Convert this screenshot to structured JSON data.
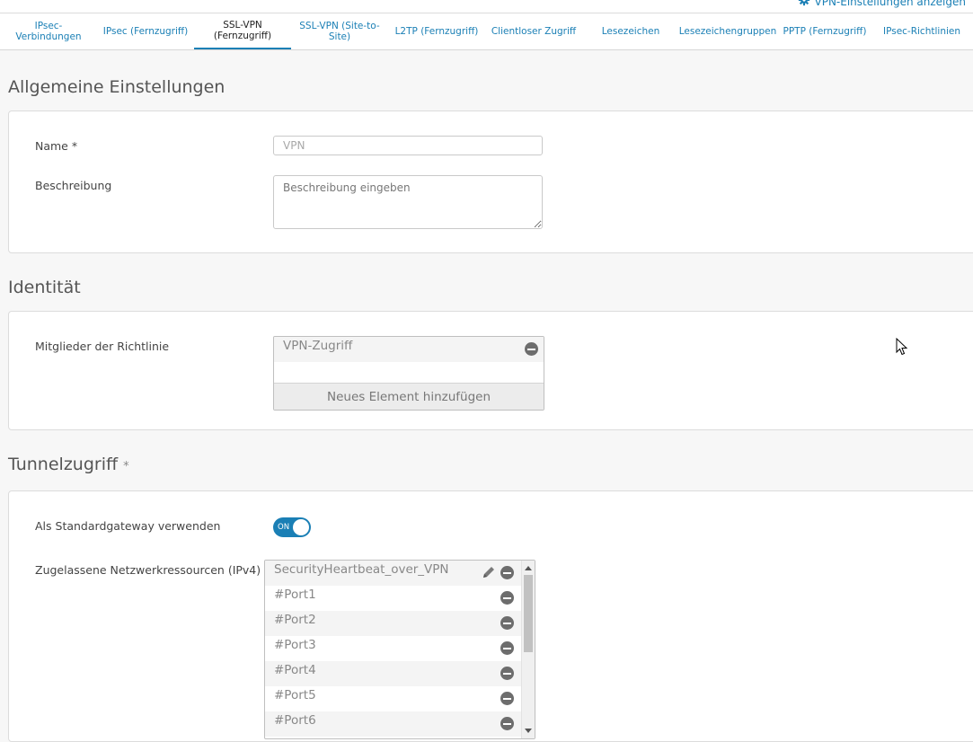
{
  "header": {
    "vpn_settings_link": "VPN-Einstellungen anzeigen"
  },
  "tabs": [
    {
      "label": "IPsec-\nVerbindungen",
      "active": false
    },
    {
      "label": "IPsec (Fernzugriff)",
      "active": false
    },
    {
      "label": "SSL-VPN\n(Fernzugriff)",
      "active": true
    },
    {
      "label": "SSL-VPN (Site-to-\nSite)",
      "active": false
    },
    {
      "label": "L2TP (Fernzugriff)",
      "active": false
    },
    {
      "label": "Clientloser Zugriff",
      "active": false
    },
    {
      "label": "Lesezeichen",
      "active": false
    },
    {
      "label": "Lesezeichengruppen",
      "active": false
    },
    {
      "label": "PPTP (Fernzugriff)",
      "active": false
    },
    {
      "label": "IPsec-Richtlinien",
      "active": false
    }
  ],
  "general": {
    "title": "Allgemeine Einstellungen",
    "name_label": "Name *",
    "name_value": "VPN",
    "description_label": "Beschreibung",
    "description_placeholder": "Beschreibung eingeben"
  },
  "identity": {
    "title": "Identität",
    "members_label": "Mitglieder der Richtlinie",
    "members": [
      "VPN-Zugriff"
    ],
    "add_element": "Neues Element hinzufügen"
  },
  "tunnel": {
    "title": "Tunnelzugriff",
    "required_mark": "*",
    "default_gateway_label": "Als Standardgateway verwenden",
    "default_gateway_toggle": "ON",
    "resources_label": "Zugelassene Netzwerkressourcen (IPv4)",
    "resources": [
      "SecurityHeartbeat_over_VPN",
      "#Port1",
      "#Port2",
      "#Port3",
      "#Port4",
      "#Port5",
      "#Port6"
    ]
  },
  "colors": {
    "accent": "#1a7fb5",
    "background": "#f7f7f7"
  },
  "icons": {
    "settings": "gear-icon",
    "edit": "pencil-icon",
    "remove": "minus-circle-icon"
  }
}
